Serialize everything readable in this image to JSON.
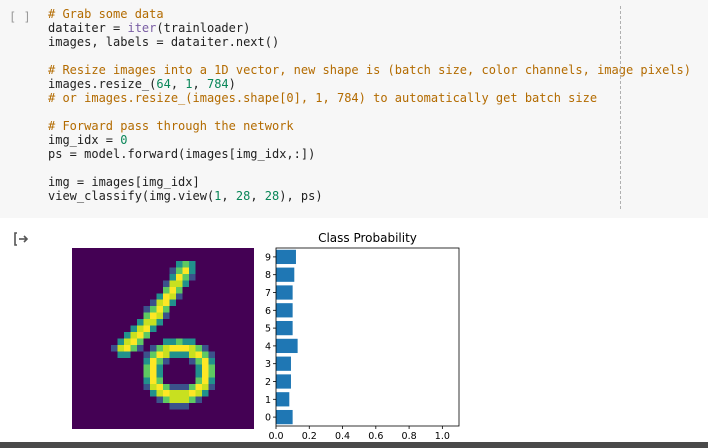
{
  "cell": {
    "run_indicator": "[ ]",
    "code_lines": [
      [
        {
          "t": "# Grab some data",
          "c": "comment"
        }
      ],
      [
        {
          "t": "dataiter = ",
          "c": ""
        },
        {
          "t": "iter",
          "c": "builtin"
        },
        {
          "t": "(trainloader)",
          "c": ""
        }
      ],
      [
        {
          "t": "images, labels = dataiter.next()",
          "c": ""
        }
      ],
      [],
      [
        {
          "t": "# Resize images into a 1D vector, new shape is (batch size, color channels, image pixels)",
          "c": "comment"
        }
      ],
      [
        {
          "t": "images.resize_(",
          "c": ""
        },
        {
          "t": "64",
          "c": "number"
        },
        {
          "t": ", ",
          "c": ""
        },
        {
          "t": "1",
          "c": "number"
        },
        {
          "t": ", ",
          "c": ""
        },
        {
          "t": "784",
          "c": "number"
        },
        {
          "t": ")",
          "c": ""
        }
      ],
      [
        {
          "t": "# or images.resize_(images.shape[0], 1, 784) to automatically get batch size",
          "c": "comment"
        }
      ],
      [],
      [
        {
          "t": "# Forward pass through the network",
          "c": "comment"
        }
      ],
      [
        {
          "t": "img_idx = ",
          "c": ""
        },
        {
          "t": "0",
          "c": "number"
        }
      ],
      [
        {
          "t": "ps = model.forward(images[img_idx,:])",
          "c": ""
        }
      ],
      [],
      [
        {
          "t": "img = images[img_idx]",
          "c": ""
        }
      ],
      [
        {
          "t": "view_classify(img.view(",
          "c": ""
        },
        {
          "t": "1",
          "c": "number"
        },
        {
          "t": ", ",
          "c": ""
        },
        {
          "t": "28",
          "c": "number"
        },
        {
          "t": ", ",
          "c": ""
        },
        {
          "t": "28",
          "c": "number"
        },
        {
          "t": "), ps)",
          "c": ""
        }
      ]
    ]
  },
  "output": {
    "icon": "output-arrow-icon"
  },
  "colors": {
    "comment": "#b36b00",
    "builtin": "#795da3",
    "number": "#098658",
    "bar": "#1f77b4",
    "bg": "#440154"
  },
  "chart_data": {
    "type": "bar",
    "orientation": "horizontal",
    "title": "Class Probability",
    "categories": [
      "0",
      "1",
      "2",
      "3",
      "4",
      "5",
      "6",
      "7",
      "8",
      "9"
    ],
    "values": [
      0.1,
      0.08,
      0.09,
      0.09,
      0.13,
      0.1,
      0.1,
      0.1,
      0.11,
      0.12
    ],
    "x_ticks": [
      "0.0",
      "0.2",
      "0.4",
      "0.6",
      "0.8",
      "1.0"
    ],
    "xlim": [
      0,
      1.1
    ],
    "grid": false
  }
}
